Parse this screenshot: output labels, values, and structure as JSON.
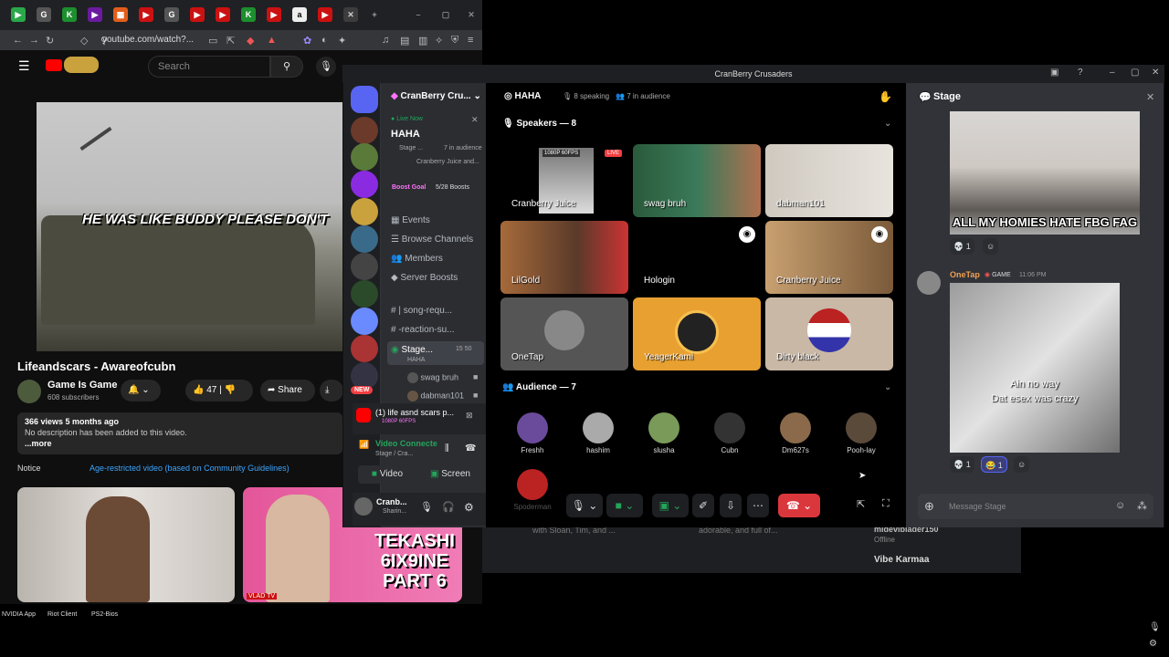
{
  "browser": {
    "url": "youtube.com/watch?...",
    "tab_icons": [
      "G",
      "K",
      "G",
      "K",
      "a"
    ]
  },
  "youtube": {
    "search_placeholder": "Search",
    "caption": "HE WAS LIKE BUDDY PLEASE DON'T",
    "title": "Lifeandscars - Awareofcubn",
    "channel": "Game Is Game",
    "subscribers": "608 subscribers",
    "likes": "47",
    "share": "Share",
    "views": "366 views  5 months ago",
    "description": "No description has been added to this video.",
    "more": "...more",
    "notice_label": "Notice",
    "notice_link": "Age-restricted video (based on Community Guidelines)",
    "thumb2_text": "TEKASHI 6IX9INE PART 6",
    "thumb2_badge": "VLAD TV"
  },
  "taskbar": {
    "items": [
      "NVIDIA App",
      "Riot Client",
      "PS2-Bios"
    ]
  },
  "background_window": {
    "text1": "with Sloan, Tim, and ...",
    "text2": "adorable, and full of...",
    "user": "mideviblader150",
    "status": "Offline",
    "user2": "Vibe Karmaa"
  },
  "discord": {
    "window_title": "CranBerry Crusaders",
    "server_name": "CranBerry Cru...",
    "live_label": "Live Now",
    "live_stage": "HAHA",
    "live_sub1": "Stage ...",
    "live_sub2": "7 in audience",
    "live_sub3": "Cranberry Juice and...",
    "boost_goal": "Boost Goal",
    "boosts": "5/28 Boosts",
    "nav": [
      "Events",
      "Browse Channels",
      "Members",
      "Server Boosts"
    ],
    "channels": [
      "| song-requ...",
      "-reaction-su..."
    ],
    "stage_channel": "Stage...",
    "stage_sub": "HAHA",
    "stage_counts": "15  50",
    "stage_members": [
      "swag bruh",
      "dabman101"
    ],
    "new_badge": "NEW",
    "activity_title": "(1) life asnd scars p...",
    "activity_sub": "1080P 60FPS",
    "voice_status": "Video Connecte",
    "voice_sub": "Stage / Cra...",
    "video_btn": "Video",
    "screen_btn": "Screen",
    "user_name": "Cranb...",
    "user_status": "Sharin...",
    "stage_title": "HAHA",
    "speaking": "8 speaking",
    "in_audience": "7 in audience",
    "speakers_header": "Speakers — 8",
    "speakers": [
      "Cranberry Juice",
      "swag bruh",
      "dabman101",
      "LilGold",
      "Hologin",
      "Cranberry Juice",
      "OneTap",
      "YeagerKami",
      "Dirty black"
    ],
    "stream_quality": "1080P 60FPS",
    "live_badge": "LIVE",
    "audience_header": "Audience — 7",
    "audience": [
      "Freshh",
      "hashim",
      "slusha",
      "Cubn",
      "Dm627s",
      "Pooh-lay",
      "Spoderman"
    ],
    "chat_title": "Stage",
    "meme_text": "ALL MY HOMIES HATE FBG FAG",
    "msg_author": "OneTap",
    "msg_tag": "GAME",
    "msg_time": "11:06 PM",
    "meme2_line1": "Ain no way",
    "meme2_line2": "Dat esex was crazy",
    "react_count": "1",
    "message_placeholder": "Message Stage"
  }
}
